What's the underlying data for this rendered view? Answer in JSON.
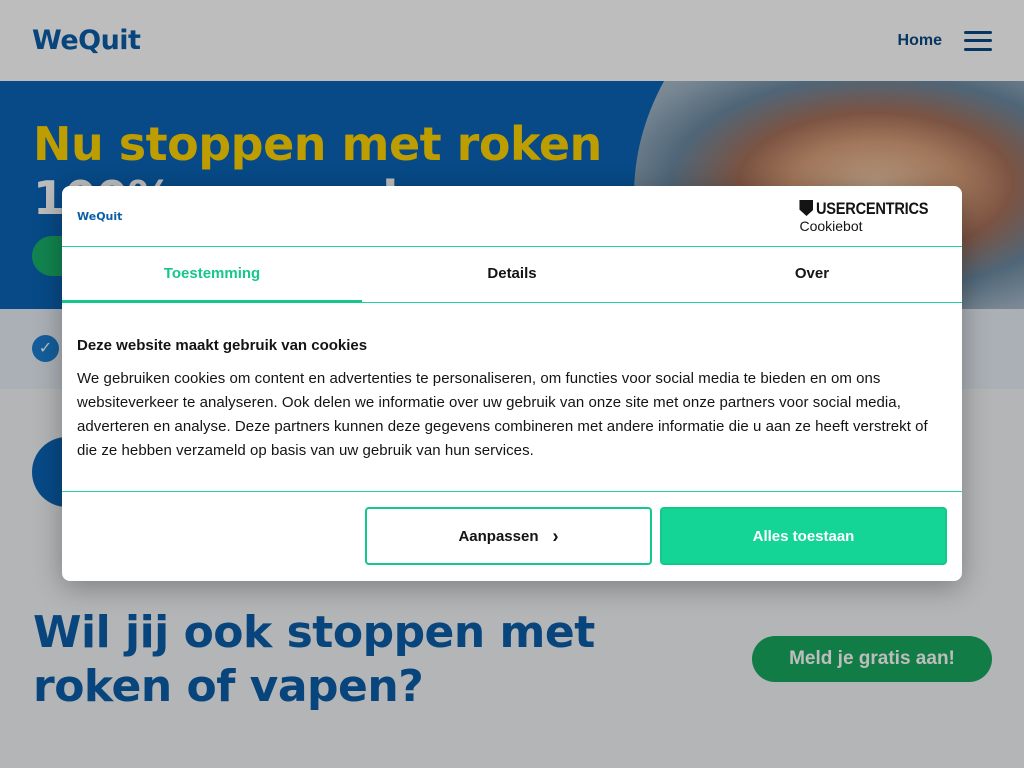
{
  "header": {
    "logo_text": "WeQuit",
    "nav_home": "Home"
  },
  "hero": {
    "title_line1": "Nu stoppen met roken",
    "title_line2": "100% vergoed"
  },
  "bottom": {
    "title": "Wil jij ook stoppen met roken of vapen?",
    "cta_label": "Meld je gratis aan!"
  },
  "cookie_dialog": {
    "logo_text": "WeQuit",
    "brand_name": "USERCENTRICS",
    "brand_sub": "Cookiebot",
    "tabs": [
      {
        "label": "Toestemming",
        "active": true
      },
      {
        "label": "Details",
        "active": false
      },
      {
        "label": "Over",
        "active": false
      }
    ],
    "heading": "Deze website maakt gebruik van cookies",
    "body": "We gebruiken cookies om content en advertenties te personaliseren, om functies voor social media te bieden en om ons websiteverkeer te analyseren. Ook delen we informatie over uw gebruik van onze site met onze partners voor social media, adverteren en analyse. Deze partners kunnen deze gegevens combineren met andere informatie die u aan ze heeft verstrekt of die ze hebben verzameld op basis van uw gebruik van hun services.",
    "customize_label": "Aanpassen",
    "allow_all_label": "Alles toestaan"
  },
  "colors": {
    "brand_blue": "#0a5ea8",
    "accent_green": "#14c88c",
    "hero_yellow": "#ffd400"
  },
  "icons": {
    "menu": "hamburger-icon",
    "usp_check": "check-icon",
    "customize_chevron": "chevron-right-icon",
    "brand": "shield-icon"
  }
}
